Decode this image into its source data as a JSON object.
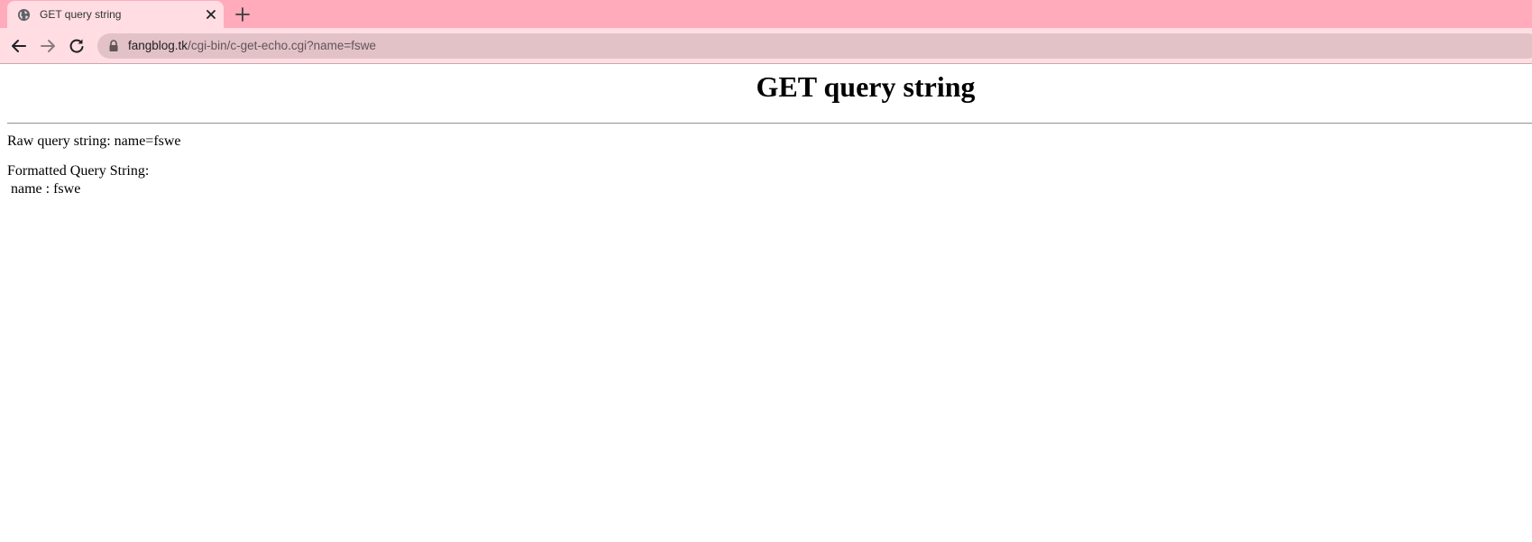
{
  "browser": {
    "tab": {
      "title": "GET query string",
      "icon": "globe-icon"
    },
    "new_tab_icon": "plus-icon",
    "nav": {
      "back_icon": "back-arrow-icon",
      "forward_icon": "forward-arrow-icon",
      "reload_icon": "reload-icon"
    },
    "address": {
      "lock_icon": "lock-icon",
      "host": "fangblog.tk",
      "path": "/cgi-bin/c-get-echo.cgi?name=fswe"
    }
  },
  "page": {
    "heading": "GET query string",
    "raw_label": "Raw query string: name=fswe",
    "formatted_label": "Formatted Query String:",
    "formatted_entries": [
      " name : fswe"
    ]
  }
}
